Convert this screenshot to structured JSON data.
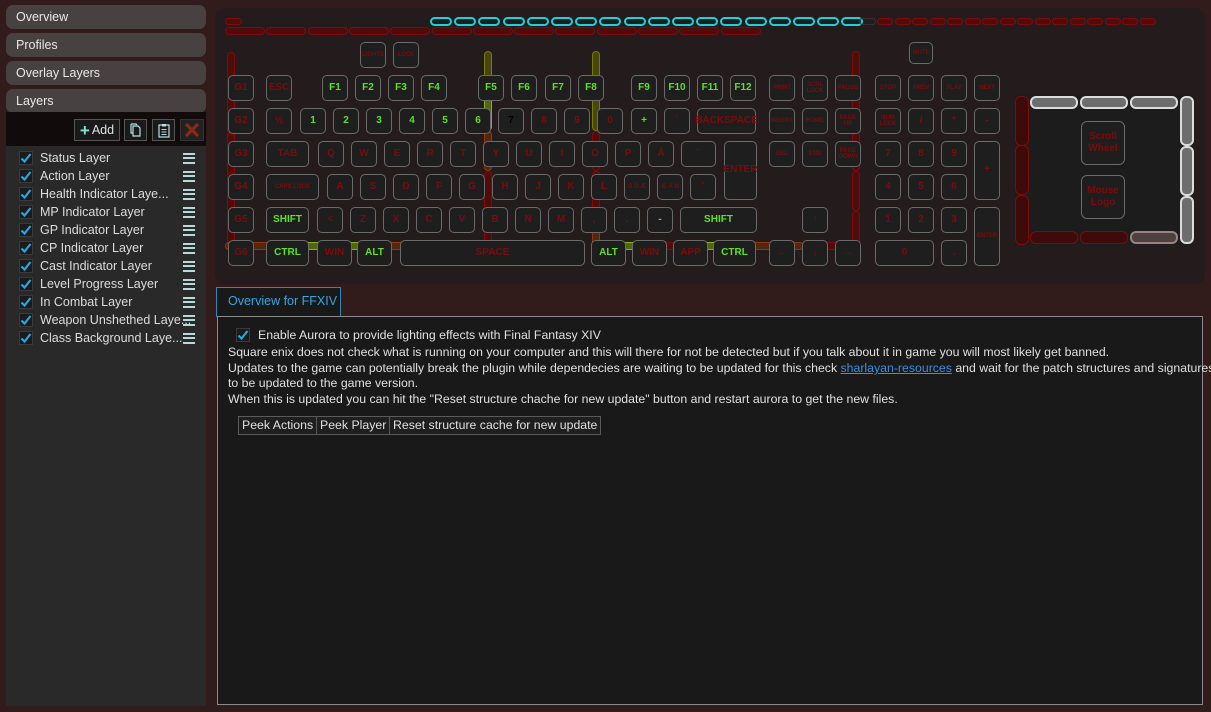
{
  "sidebar": {
    "nav": [
      {
        "label": "Overview"
      },
      {
        "label": "Profiles"
      },
      {
        "label": "Overlay Layers"
      },
      {
        "label": "Layers"
      }
    ],
    "toolbar": {
      "add_label": "Add",
      "add_icon": "plus-icon",
      "copy_icon": "copy-icon",
      "paste_icon": "clipboard-icon",
      "delete_icon": "close-icon"
    },
    "layers": [
      {
        "name": "Status Layer",
        "enabled": true
      },
      {
        "name": "Action Layer",
        "enabled": true
      },
      {
        "name": "Health Indicator Laye...",
        "enabled": true
      },
      {
        "name": "MP Indicator Layer",
        "enabled": true
      },
      {
        "name": "GP Indicator Layer",
        "enabled": true
      },
      {
        "name": "CP Indicator Layer",
        "enabled": true
      },
      {
        "name": "Cast Indicator Layer",
        "enabled": true
      },
      {
        "name": "Level Progress Layer",
        "enabled": true
      },
      {
        "name": "In Combat Layer",
        "enabled": true
      },
      {
        "name": "Weapon Unshethed Laye...",
        "enabled": true
      },
      {
        "name": "Class Background Laye...",
        "enabled": true
      }
    ]
  },
  "keyboard": {
    "colors": {
      "inactive_text": "#7a0c0c",
      "active_text": "#60e020",
      "cyan": "#1ed0d8",
      "key_border": "#6a6a6a"
    },
    "keys": {
      "lights": "LIGHTS",
      "lock": "LOCK",
      "mute": "MUTE",
      "g1": "G1",
      "g2": "G2",
      "g3": "G3",
      "g4": "G4",
      "g5": "G5",
      "g6": "G6",
      "esc": "ESC",
      "f1": "F1",
      "f2": "F2",
      "f3": "F3",
      "f4": "F4",
      "f5": "F5",
      "f6": "F6",
      "f7": "F7",
      "f8": "F8",
      "f9": "F9",
      "f10": "F10",
      "f11": "F11",
      "f12": "F12",
      "print": "PRINT",
      "scrl": "SCRL LOCK",
      "pause": "PAUSE",
      "stop": "STOP",
      "prev": "PREV",
      "play": "PLAY",
      "next": "NEXT",
      "half": "½",
      "n1": "1",
      "n2": "2",
      "n3": "3",
      "n4": "4",
      "n5": "5",
      "n6": "6",
      "n7": "7",
      "n8": "8",
      "n9": "9",
      "n0": "0",
      "plus": "+",
      "acute": "´",
      "backspace": "BACKSPACE",
      "insert": "INSERT",
      "home": "HOME",
      "pgup": "PAGE UP",
      "numlock": "NUM LOCK",
      "npdiv": "/",
      "npmul": "*",
      "npsub": "-",
      "tab": "TAB",
      "q": "Q",
      "w": "W",
      "e": "E",
      "r": "R",
      "t": "T",
      "y": "Y",
      "u": "U",
      "i": "I",
      "o": "O",
      "p": "P",
      "aring": "Å",
      "diaer": "¨",
      "enter": "ENTER",
      "del": "DEL",
      "end": "END",
      "pgdn": "PAGE DOWN",
      "np7": "7",
      "np8": "8",
      "np9": "9",
      "npadd": "+",
      "caps": "CAPS LOCK",
      "a": "A",
      "s": "S",
      "d": "D",
      "f": "F",
      "g": "G",
      "h": "H",
      "j": "J",
      "k": "K",
      "l": "L",
      "oe": "Ø Ö Æ",
      "ae": "Æ Ä Ø",
      "apos": "'",
      "np4": "4",
      "np5": "5",
      "np6": "6",
      "lshift": "SHIFT",
      "lt": "<",
      "z": "Z",
      "x": "X",
      "c": "C",
      "v": "V",
      "b": "B",
      "n": "N",
      "m": "M",
      "comma": ",",
      "period": ".",
      "minus": "-",
      "rshift": "SHIFT",
      "up": "↑",
      "np1": "1",
      "np2": "2",
      "np3": "3",
      "npenter": "ENTER",
      "lctrl": "CTRL",
      "lwin": "WIN",
      "lalt": "ALT",
      "space": "SPACE",
      "ralt": "ALT",
      "rwin": "WIN",
      "app": "APP",
      "rctrl": "CTRL",
      "left": "←",
      "down": "↓",
      "right": "→",
      "np0": "0",
      "npdot": ".",
      "scroll_wheel": "Scroll Wheel",
      "mouse_logo": "Mouse Logo"
    }
  },
  "tab": {
    "label": "Overview for FFXIV"
  },
  "content": {
    "enable_label": "Enable Aurora to provide lighting effects with Final Fantasy XIV",
    "enable_checked": true,
    "line1": "Square enix does not check what is running on your computer and this will there for not be detected but if you talk about it in game you will most likely get banned.",
    "line2_before": "Updates to the game can potentially break the plugin while dependecies are waiting to be updated for this check ",
    "line2_link": "sharlayan-resources",
    "line2_after": " and wait for the patch structures and signatures",
    "line3": "to be updated to the game version.",
    "line4": "When this is updated you can hit the \"Reset structure chache for new update\" button and restart aurora to get the new files.",
    "buttons": {
      "peek_actions": "Peek Actions",
      "peek_player": "Peek Player",
      "reset_cache": "Reset structure cache for new update"
    }
  }
}
